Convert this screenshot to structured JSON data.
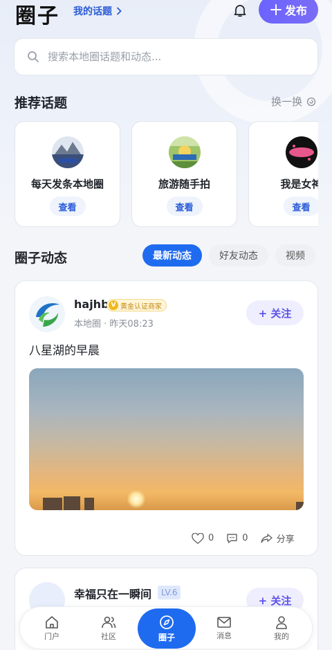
{
  "header": {
    "title": "圈子",
    "my_topics": "我的话题",
    "publish_label": "发布"
  },
  "search": {
    "placeholder": "搜索本地圈话题和动态..."
  },
  "recommended": {
    "title": "推荐话题",
    "refresh_label": "换一换",
    "topics": [
      {
        "name": "每天发条本地圈",
        "action": "查看"
      },
      {
        "name": "旅游随手拍",
        "action": "查看"
      },
      {
        "name": "我是女神",
        "action": "查看"
      }
    ]
  },
  "feed": {
    "title": "圈子动态",
    "tabs": [
      {
        "label": "最新动态",
        "active": true
      },
      {
        "label": "好友动态",
        "active": false
      },
      {
        "label": "视频",
        "active": false
      }
    ]
  },
  "posts": [
    {
      "user": "hajhb",
      "badge": "黄金认证商家",
      "meta": "本地圈 · 昨天08:23",
      "follow_label": "+ 关注",
      "text": "八星湖的早晨",
      "likes": "0",
      "comments": "0",
      "share_label": "分享"
    },
    {
      "user": "幸福只在一瞬间",
      "level": "LV.6",
      "follow_label": "+ 关注"
    }
  ],
  "nav": {
    "items": [
      {
        "label": "门户",
        "icon": "home-icon"
      },
      {
        "label": "社区",
        "icon": "community-icon"
      },
      {
        "label": "圈子",
        "icon": "compass-icon",
        "active": true
      },
      {
        "label": "消息",
        "icon": "mail-icon"
      },
      {
        "label": "我的",
        "icon": "user-icon"
      }
    ]
  },
  "colors": {
    "accent": "#1f6bf0",
    "publish": "#6c63ff",
    "link": "#2a5bd7"
  }
}
